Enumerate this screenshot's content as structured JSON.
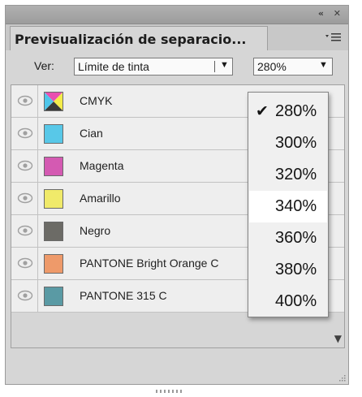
{
  "title_bar": {
    "collapse_icon": "double-chevron-left-icon",
    "close_icon": "close-icon"
  },
  "panel": {
    "tab_title": "Previsualización de separacio...",
    "menu_icon": "panel-menu-icon"
  },
  "controls": {
    "ver_label": "Ver:",
    "mode_value": "Límite de tinta",
    "zoom_value": "280%"
  },
  "separations": [
    {
      "label": "CMYK",
      "color": "cmyk"
    },
    {
      "label": "Cian",
      "color": "#58c8e8"
    },
    {
      "label": "Magenta",
      "color": "#d45ab2"
    },
    {
      "label": "Amarillo",
      "color": "#f0ea6a"
    },
    {
      "label": "Negro",
      "color": "#6c6b66"
    },
    {
      "label": "PANTONE Bright Orange C",
      "color": "#ee9a6a"
    },
    {
      "label": "PANTONE 315 C",
      "color": "#5a9aa4"
    }
  ],
  "dropdown": {
    "options": [
      "280%",
      "300%",
      "320%",
      "340%",
      "360%",
      "380%",
      "400%"
    ],
    "selected": "280%",
    "hovered": "340%",
    "check_icon": "checkmark-icon"
  }
}
